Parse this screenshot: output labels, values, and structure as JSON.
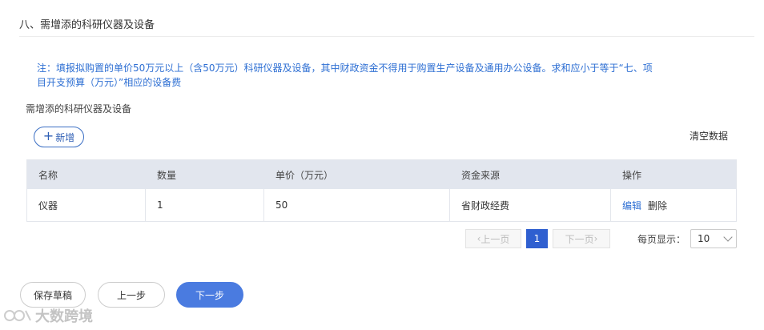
{
  "section": {
    "title": "八、需增添的科研仪器及设备"
  },
  "note": {
    "text": "注：填报拟购置的单价50万元以上（含50万元）科研仪器及设备，其中财政资金不得用于购置生产设备及通用办公设备。求和应小于等于“七、项目开支预算（万元）”相应的设备费"
  },
  "subsection": {
    "title": "需增添的科研仪器及设备"
  },
  "toolbar": {
    "add_label": "新增",
    "add_plus": "+",
    "clear_label": "清空数据"
  },
  "table": {
    "columns": [
      "名称",
      "数量",
      "单价（万元）",
      "资金来源",
      "操作"
    ],
    "rows": [
      {
        "name": "仪器",
        "qty": "1",
        "price": "50",
        "source": "省财政经费",
        "edit": "编辑",
        "delete": "删除"
      }
    ]
  },
  "pagination": {
    "prev": "上一页",
    "next": "下一页",
    "current": "1",
    "per_page_label": "每页显示：",
    "per_page_value": "10"
  },
  "actions": {
    "save_draft": "保存草稿",
    "prev_step": "上一步",
    "next_step": "下一步"
  },
  "watermark": {
    "text": "大数跨境"
  },
  "colors": {
    "accent": "#2f5fd0",
    "note": "#2e6fd3",
    "header_bg": "#e2e6ee"
  }
}
